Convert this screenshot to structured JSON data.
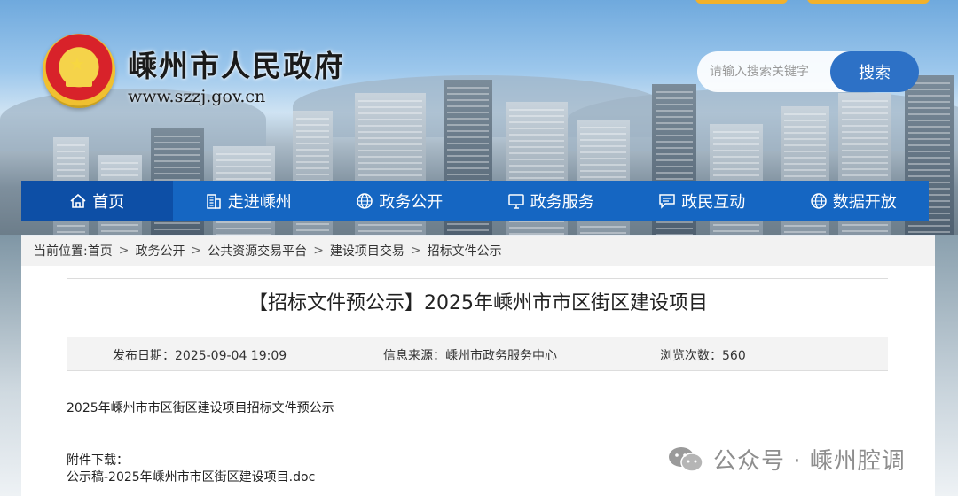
{
  "header": {
    "site_title": "嵊州市人民政府",
    "site_url": "www.szzj.gov.cn",
    "search_placeholder": "请输入搜索关键字",
    "search_button": "搜索"
  },
  "nav": {
    "items": [
      {
        "label": "首页",
        "icon": "home-icon"
      },
      {
        "label": "走进嵊州",
        "icon": "building-icon"
      },
      {
        "label": "政务公开",
        "icon": "globe-icon"
      },
      {
        "label": "政务服务",
        "icon": "monitor-icon"
      },
      {
        "label": "政民互动",
        "icon": "chat-icon"
      },
      {
        "label": "数据开放",
        "icon": "globe-icon"
      }
    ]
  },
  "breadcrumb": {
    "prefix": "当前位置:",
    "items": [
      "首页",
      "政务公开",
      "公共资源交易平台",
      "建设项目交易",
      "招标文件公示"
    ],
    "separator": ">"
  },
  "article": {
    "title": "【招标文件预公示】2025年嵊州市市区街区建设项目",
    "publish_date": "发布日期：2025-09-04 19:09",
    "source": "信息来源：嵊州市政务服务中心",
    "views": "浏览次数：560",
    "body": "2025年嵊州市市区街区建设项目招标文件预公示",
    "attachment_label": "附件下载：",
    "attachment_file": "公示稿-2025年嵊州市市区街区建设项目.doc"
  },
  "watermark": {
    "text": "公众号 · 嵊州腔调",
    "icon": "wechat-icon"
  },
  "colors": {
    "nav_bg": "#1566c2",
    "nav_active": "#0d4fa6",
    "search_btn": "#2d71c6",
    "accent_orange": "#f2b12b"
  }
}
